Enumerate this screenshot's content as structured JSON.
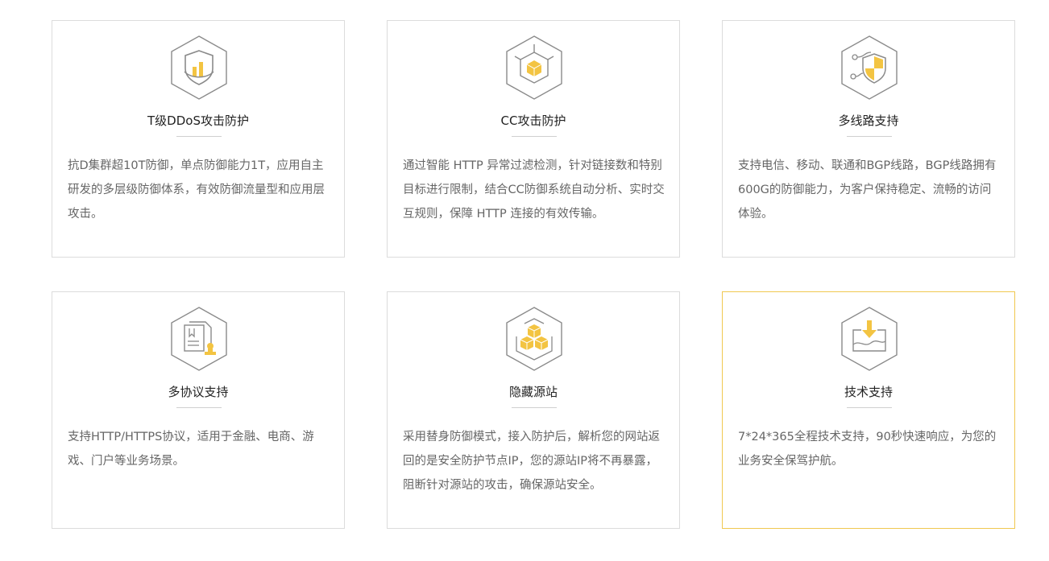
{
  "colors": {
    "accent": "#f3c442",
    "icon_stroke": "#8a8a8a",
    "border": "#dcdcdc",
    "highlight_border": "#f0c850",
    "title": "#222222",
    "text": "#666666"
  },
  "cards": [
    {
      "icon": "shield-chart-icon",
      "title": "T级DDoS攻击防护",
      "description": "抗D集群超10T防御，单点防御能力1T，应用自主研发的多层级防御体系，有效防御流量型和应用层攻击。"
    },
    {
      "icon": "cube-frame-icon",
      "title": "CC攻击防护",
      "description": "通过智能 HTTP 异常过滤检测，针对链接数和特别目标进行限制，结合CC防御系统自动分析、实时交互规则，保障 HTTP 连接的有效传输。"
    },
    {
      "icon": "multi-line-shield-icon",
      "title": "多线路支持",
      "description": "支持电信、移动、联通和BGP线路，BGP线路拥有600G的防御能力，为客户保持稳定、流畅的访问体验。"
    },
    {
      "icon": "documents-stamp-icon",
      "title": "多协议支持",
      "description": "支持HTTP/HTTPS协议，适用于金融、电商、游戏、门户等业务场景。"
    },
    {
      "icon": "stacked-cubes-icon",
      "title": "隐藏源站",
      "description": "采用替身防御模式，接入防护后，解析您的网站返回的是安全防护节点IP，您的源站IP将不再暴露，阻断针对源站的攻击，确保源站安全。"
    },
    {
      "icon": "download-tray-icon",
      "title": "技术支持",
      "description": "7*24*365全程技术支持，90秒快速响应，为您的业务安全保驾护航。"
    }
  ]
}
